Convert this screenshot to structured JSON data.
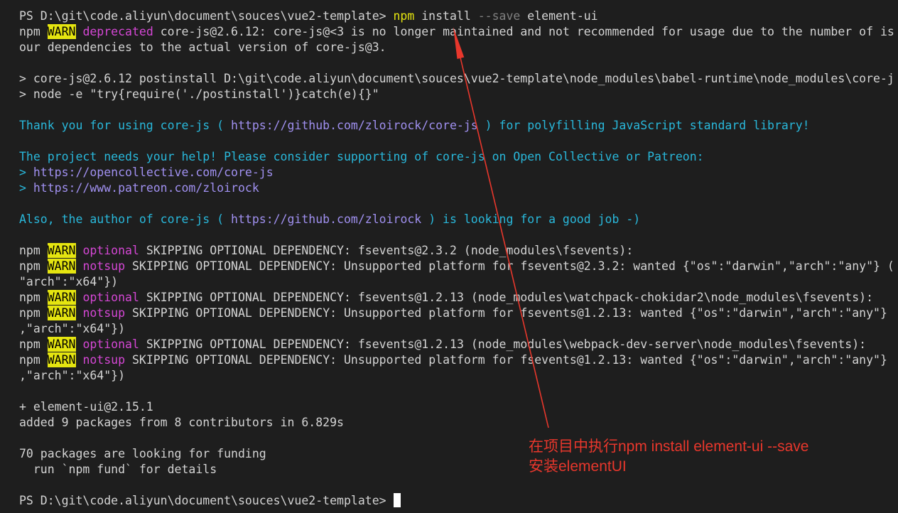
{
  "terminal": {
    "command_line": {
      "prompt": "PS D:\\git\\code.aliyun\\document\\souces\\vue2-template>",
      "program": "npm",
      "subcommand": "install",
      "flag": "--save",
      "package": "element-ui"
    },
    "deprecation_warning": {
      "prefix": "npm",
      "level": "WARN",
      "tag": "deprecated",
      "message": "core-js@2.6.12: core-js@<3 is no longer maintained and not recommended for usage due to the number of is",
      "continuation": "our dependencies to the actual version of core-js@3."
    },
    "postinstall": {
      "script_line": "> core-js@2.6.12 postinstall D:\\git\\code.aliyun\\document\\souces\\vue2-template\\node_modules\\babel-runtime\\node_modules\\core-j",
      "node_line": "> node -e \"try{require('./postinstall')}catch(e){}\""
    },
    "core_js_banner": {
      "thanks_before": "Thank you for using core-js (",
      "thanks_url": "https://github.com/zloirock/core-js",
      "thanks_after": ") for polyfilling JavaScript standard library!",
      "help_text": "The project needs your help! Please consider supporting of core-js on Open Collective or Patreon:",
      "links": [
        {
          "marker": ">",
          "url": "https://opencollective.com/core-js"
        },
        {
          "marker": ">",
          "url": "https://www.patreon.com/zloirock"
        }
      ],
      "author_before": "Also, the author of core-js (",
      "author_url": "https://github.com/zloirock",
      "author_after": ") is looking for a good job -)"
    },
    "optional_warnings": [
      {
        "prefix": "npm",
        "level": "WARN",
        "tag": "optional",
        "message": "SKIPPING OPTIONAL DEPENDENCY: fsevents@2.3.2 (node_modules\\fsevents):"
      },
      {
        "prefix": "npm",
        "level": "WARN",
        "tag": "notsup",
        "message": "SKIPPING OPTIONAL DEPENDENCY: Unsupported platform for fsevents@2.3.2: wanted {\"os\":\"darwin\",\"arch\":\"any\"} (",
        "continuation": "\"arch\":\"x64\"})"
      },
      {
        "prefix": "npm",
        "level": "WARN",
        "tag": "optional",
        "message": "SKIPPING OPTIONAL DEPENDENCY: fsevents@1.2.13 (node_modules\\watchpack-chokidar2\\node_modules\\fsevents):"
      },
      {
        "prefix": "npm",
        "level": "WARN",
        "tag": "notsup",
        "message": "SKIPPING OPTIONAL DEPENDENCY: Unsupported platform for fsevents@1.2.13: wanted {\"os\":\"darwin\",\"arch\":\"any\"}",
        "continuation": ",\"arch\":\"x64\"})"
      },
      {
        "prefix": "npm",
        "level": "WARN",
        "tag": "optional",
        "message": "SKIPPING OPTIONAL DEPENDENCY: fsevents@1.2.13 (node_modules\\webpack-dev-server\\node_modules\\fsevents):"
      },
      {
        "prefix": "npm",
        "level": "WARN",
        "tag": "notsup",
        "message": "SKIPPING OPTIONAL DEPENDENCY: Unsupported platform for fsevents@1.2.13: wanted {\"os\":\"darwin\",\"arch\":\"any\"}",
        "continuation": ",\"arch\":\"x64\"})"
      }
    ],
    "summary": {
      "installed": "+ element-ui@2.15.1",
      "added": "added 9 packages from 8 contributors in 6.829s",
      "funding": "70 packages are looking for funding",
      "funding_hint": "run `npm fund` for details"
    },
    "current_prompt": "PS D:\\git\\code.aliyun\\document\\souces\\vue2-template>"
  },
  "annotation": {
    "lines": [
      "在项目中执行npm install element-ui --save",
      "安装elementUI"
    ]
  },
  "colors": {
    "background": "#1e1e1e",
    "foreground": "#d4d4d4",
    "command": "#e5e510",
    "flag": "#808080",
    "warn_badge_bg": "#e5e510",
    "warn_badge_fg": "#000000",
    "tag": "#d547d5",
    "banner": "#29b8db",
    "url": "#a090f0",
    "cursor": "#ffffff",
    "annotation": "#e8372c"
  }
}
